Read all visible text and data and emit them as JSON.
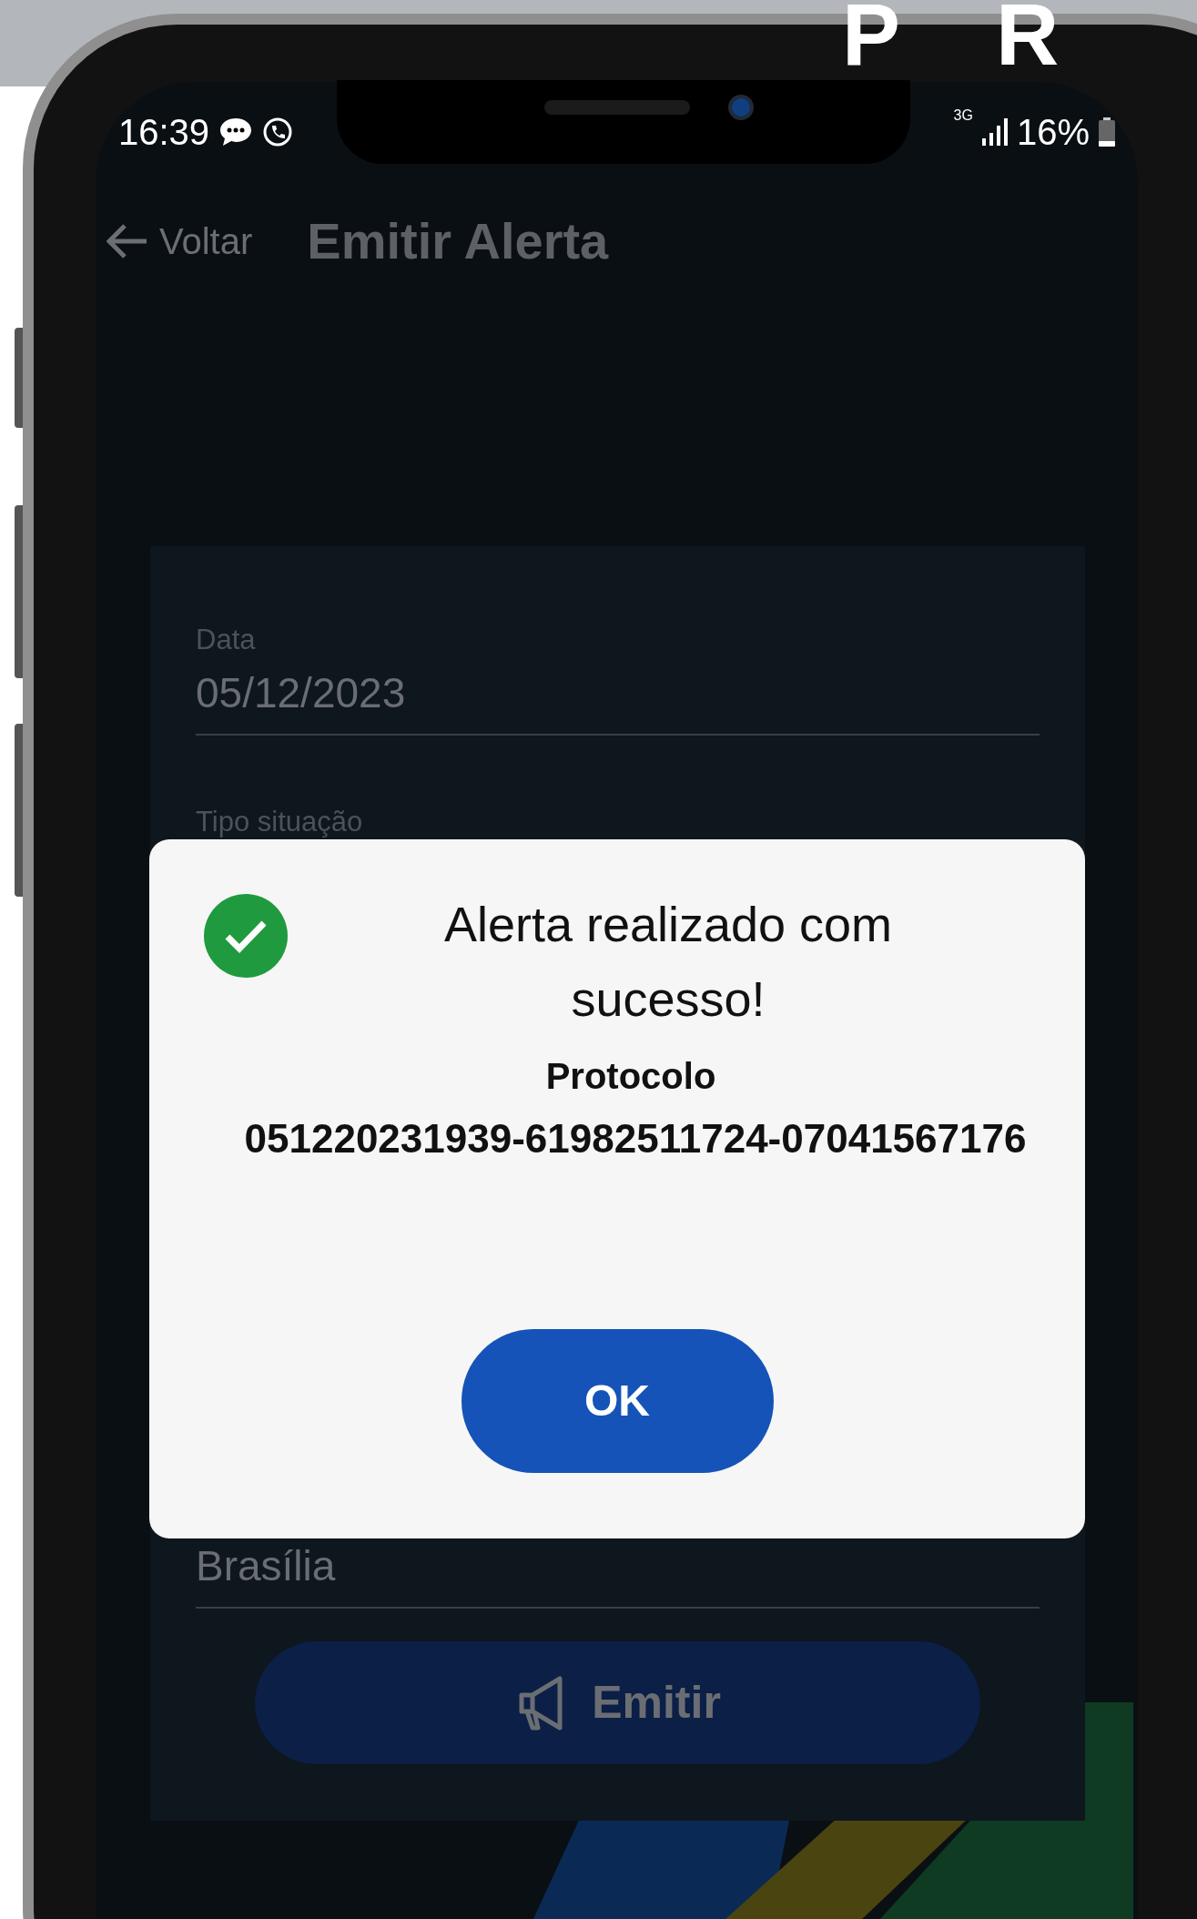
{
  "banner": {
    "text": "P R"
  },
  "status_bar": {
    "time": "16:39",
    "network": "3G",
    "battery": "16%"
  },
  "header": {
    "back": "Voltar",
    "title": "Emitir Alerta"
  },
  "form": {
    "fields": [
      {
        "label": "Data",
        "value": "05/12/2023"
      },
      {
        "label": "Tipo situação"
      },
      {
        "value": "Brasília"
      }
    ],
    "submit": "Emitir"
  },
  "dialog": {
    "title": "Alerta realizado com sucesso!",
    "subtitle": "Protocolo",
    "protocol": "051220231939-61982511724-07041567176",
    "button": "OK"
  }
}
